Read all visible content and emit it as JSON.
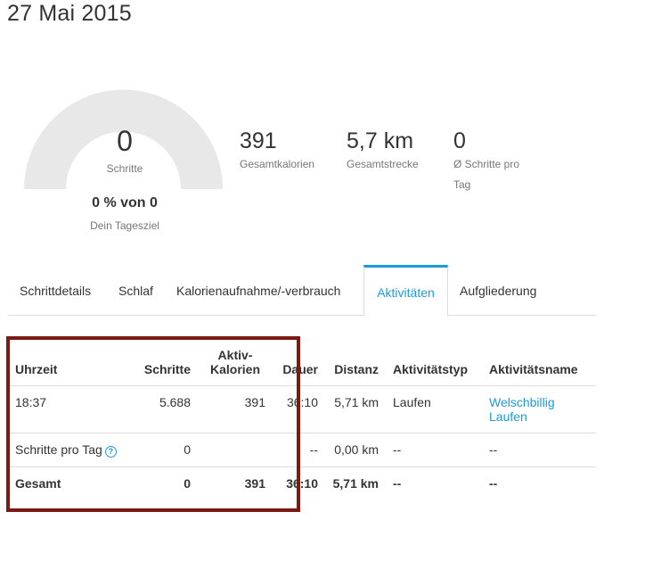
{
  "header": {
    "date": "27 Mai 2015"
  },
  "gauge": {
    "steps_value": "0",
    "steps_label": "Schritte",
    "goal_value": "0 % von 0",
    "goal_label": "Dein Tagesziel",
    "progress_fraction": 0,
    "track_color": "#e8e8e8"
  },
  "stats": [
    {
      "value": "391",
      "label": "Gesamtkalorien"
    },
    {
      "value": "5,7 km",
      "label": "Gesamtstrecke"
    },
    {
      "value": "0",
      "label_line1": "Ø Schritte pro",
      "label_line2": "Tag"
    }
  ],
  "tabs": [
    {
      "label": "Schrittdetails",
      "active": false
    },
    {
      "label": "Schlaf",
      "active": false
    },
    {
      "label": "Kalorienaufnahme/-verbrauch",
      "active": false
    },
    {
      "label": "Aktivitäten",
      "active": true
    },
    {
      "label": "Aufgliederung",
      "active": false
    }
  ],
  "table": {
    "headers": {
      "time": "Uhrzeit",
      "steps": "Schritte",
      "active_calories_line1": "Aktiv-",
      "active_calories_line2": "Kalorien",
      "duration": "Dauer",
      "distance": "Distanz",
      "activity_type": "Aktivitätstyp",
      "activity_name": "Aktivitätsname"
    },
    "rows": [
      {
        "time": "18:37",
        "steps": "5.688",
        "active_calories": "391",
        "duration": "36:10",
        "distance": "5,71 km",
        "activity_type": "Laufen",
        "activity_name_line1": "Welschbillig",
        "activity_name_line2": "Laufen"
      },
      {
        "time": "Schritte pro Tag",
        "steps": "0",
        "active_calories": "",
        "duration": "--",
        "distance": "0,00 km",
        "activity_type": "--",
        "activity_name": "--"
      }
    ],
    "total": {
      "label": "Gesamt",
      "steps": "0",
      "active_calories": "391",
      "duration": "36:10",
      "distance": "5,71 km",
      "activity_type": "--",
      "activity_name": "--"
    }
  },
  "colors": {
    "accent": "#1d9bd8",
    "highlight_border": "#7b1a12"
  }
}
